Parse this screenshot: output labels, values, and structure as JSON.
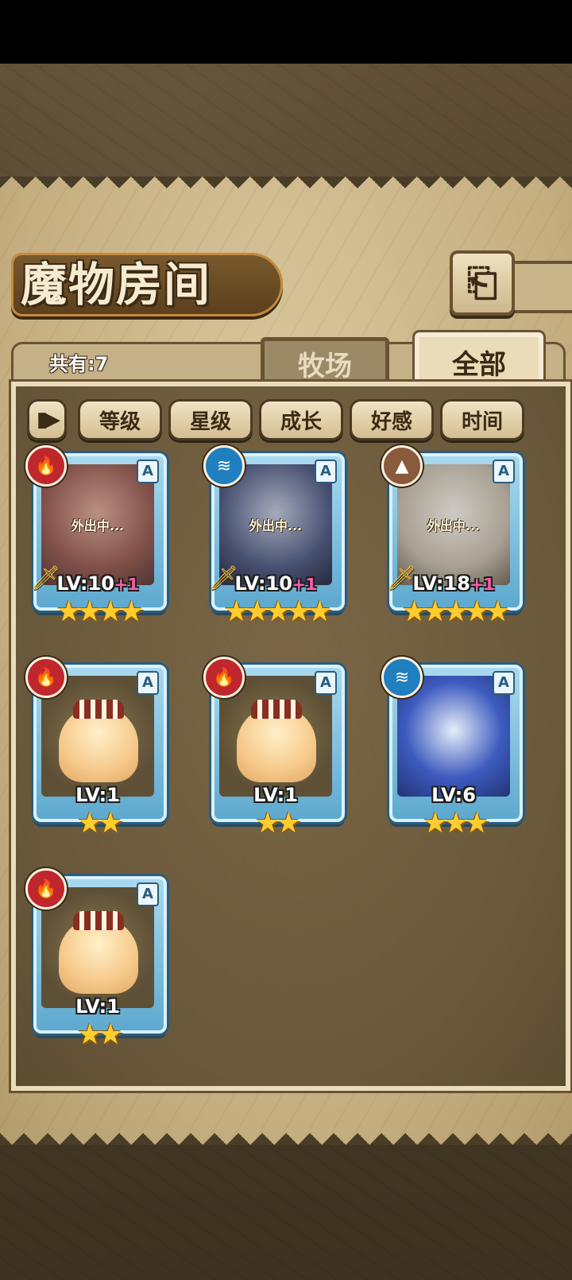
{
  "title": "魔物房间",
  "back_icon": "⎗",
  "count_label": "共有:7",
  "tabs": {
    "ranch": "牧场",
    "all": "全部"
  },
  "sort_buttons": [
    "等级",
    "星级",
    "成长",
    "好感",
    "时间"
  ],
  "away_text": "外出中...",
  "cards": [
    {
      "element": "fire",
      "rank": "A",
      "level": "LV:10",
      "plus": "+1",
      "stars": "★★★★",
      "away": true,
      "weapon": true
    },
    {
      "element": "water",
      "rank": "A",
      "level": "LV:10",
      "plus": "+1",
      "stars": "★★★★★",
      "away": true,
      "weapon": true
    },
    {
      "element": "earth",
      "rank": "A",
      "level": "LV:18",
      "plus": "+1",
      "stars": "★★★★★",
      "away": true,
      "weapon": true
    },
    {
      "element": "fire",
      "rank": "A",
      "level": "LV:1",
      "plus": "",
      "stars": "★★",
      "away": false,
      "weapon": false
    },
    {
      "element": "fire",
      "rank": "A",
      "level": "LV:1",
      "plus": "",
      "stars": "★★",
      "away": false,
      "weapon": false
    },
    {
      "element": "water",
      "rank": "A",
      "level": "LV:6",
      "plus": "",
      "stars": "★★★",
      "away": false,
      "weapon": false
    },
    {
      "element": "fire",
      "rank": "A",
      "level": "LV:1",
      "plus": "",
      "stars": "★★",
      "away": false,
      "weapon": false
    }
  ]
}
